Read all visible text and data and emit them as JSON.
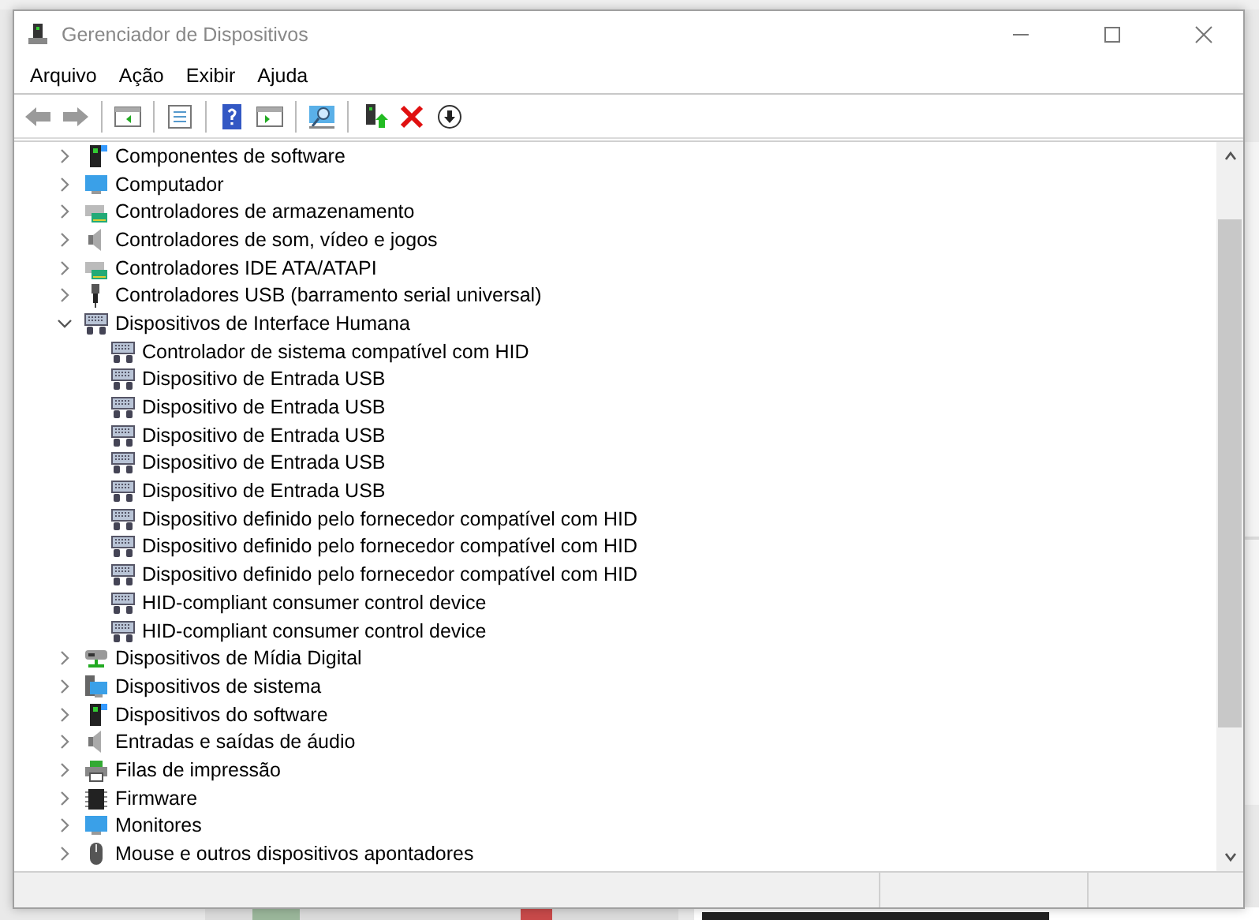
{
  "window": {
    "title": "Gerenciador de Dispositivos"
  },
  "menu": [
    "Arquivo",
    "Ação",
    "Exibir",
    "Ajuda"
  ],
  "tree": [
    {
      "label": "Componentes de software",
      "expanded": false
    },
    {
      "label": "Computador",
      "expanded": false
    },
    {
      "label": "Controladores de armazenamento",
      "expanded": false
    },
    {
      "label": "Controladores de som, vídeo e jogos",
      "expanded": false
    },
    {
      "label": "Controladores IDE ATA/ATAPI",
      "expanded": false
    },
    {
      "label": "Controladores USB (barramento serial universal)",
      "expanded": false
    },
    {
      "label": "Dispositivos de Interface Humana",
      "expanded": true,
      "children": [
        {
          "label": "Controlador de sistema compatível com HID"
        },
        {
          "label": "Dispositivo de Entrada USB"
        },
        {
          "label": "Dispositivo de Entrada USB"
        },
        {
          "label": "Dispositivo de Entrada USB"
        },
        {
          "label": "Dispositivo de Entrada USB"
        },
        {
          "label": "Dispositivo de Entrada USB"
        },
        {
          "label": "Dispositivo definido pelo fornecedor compatível com HID"
        },
        {
          "label": "Dispositivo definido pelo fornecedor compatível com HID"
        },
        {
          "label": "Dispositivo definido pelo fornecedor compatível com HID"
        },
        {
          "label": "HID-compliant consumer control device"
        },
        {
          "label": "HID-compliant consumer control device"
        }
      ]
    },
    {
      "label": "Dispositivos de Mídia Digital",
      "expanded": false
    },
    {
      "label": "Dispositivos de sistema",
      "expanded": false
    },
    {
      "label": "Dispositivos do software",
      "expanded": false
    },
    {
      "label": "Entradas e saídas de áudio",
      "expanded": false
    },
    {
      "label": "Filas de impressão",
      "expanded": false
    },
    {
      "label": "Firmware",
      "expanded": false
    },
    {
      "label": "Monitores",
      "expanded": false
    },
    {
      "label": "Mouse e outros dispositivos apontadores",
      "expanded": false
    }
  ]
}
